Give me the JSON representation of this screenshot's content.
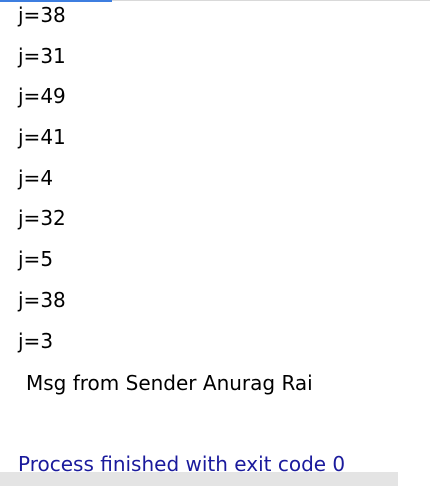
{
  "console": {
    "output_lines": [
      "j=38",
      "j=31",
      "j=49",
      "j=41",
      "j=4",
      "j=32",
      "j=5",
      "j=38",
      "j=3"
    ],
    "message": "Msg from Sender Anurag Rai",
    "exit_status": "Process finished with exit code 0"
  },
  "colors": {
    "output_text": "#000000",
    "exit_status_text": "#1a1a9c",
    "accent": "#3d7ee0"
  }
}
